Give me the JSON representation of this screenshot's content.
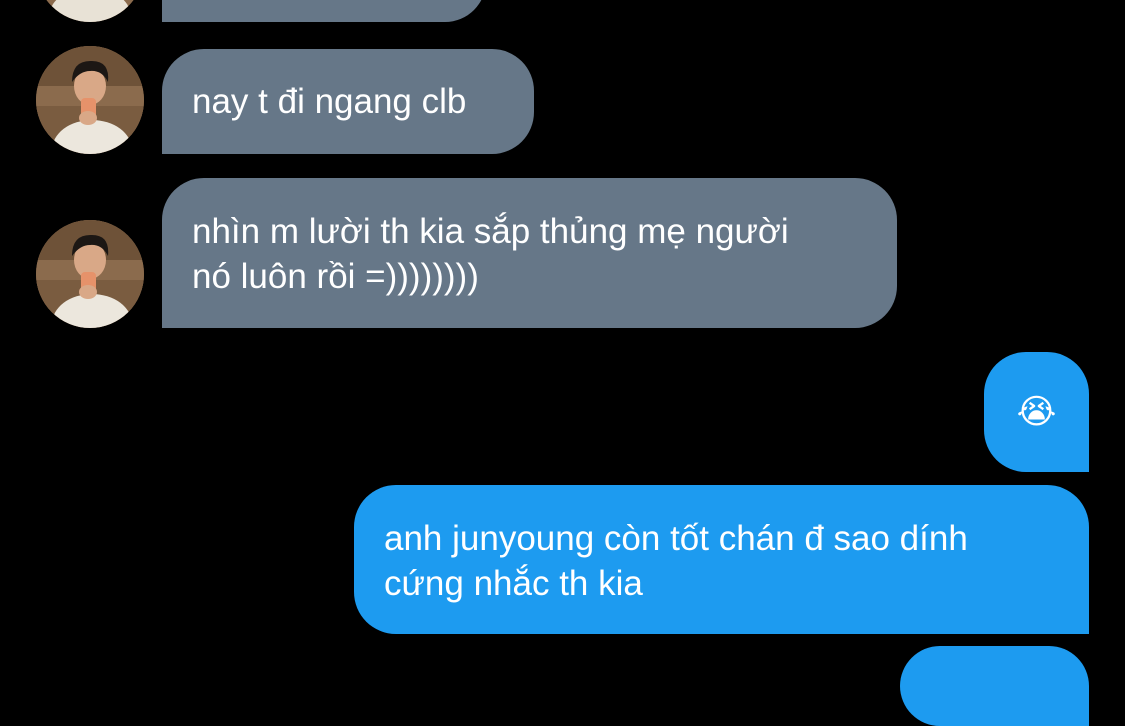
{
  "colors": {
    "background": "#000000",
    "incoming_bubble": "#667788",
    "outgoing_bubble": "#1d9bf0",
    "text": "#ffffff"
  },
  "messages": [
    {
      "direction": "incoming",
      "avatar": "avatar",
      "lines": [
        "nay t đi ngang clb"
      ]
    },
    {
      "direction": "incoming",
      "avatar": "avatar",
      "lines": [
        "nhìn m lười th kia sắp thủng mẹ người",
        "nó luôn rồi =))))))))"
      ]
    },
    {
      "direction": "outgoing",
      "emoji": "😭",
      "emoji_name": "loudly-crying-face-icon"
    },
    {
      "direction": "outgoing",
      "lines": [
        "anh junyoung còn tốt chán đ sao dính",
        "cứng nhắc th kia"
      ]
    }
  ]
}
